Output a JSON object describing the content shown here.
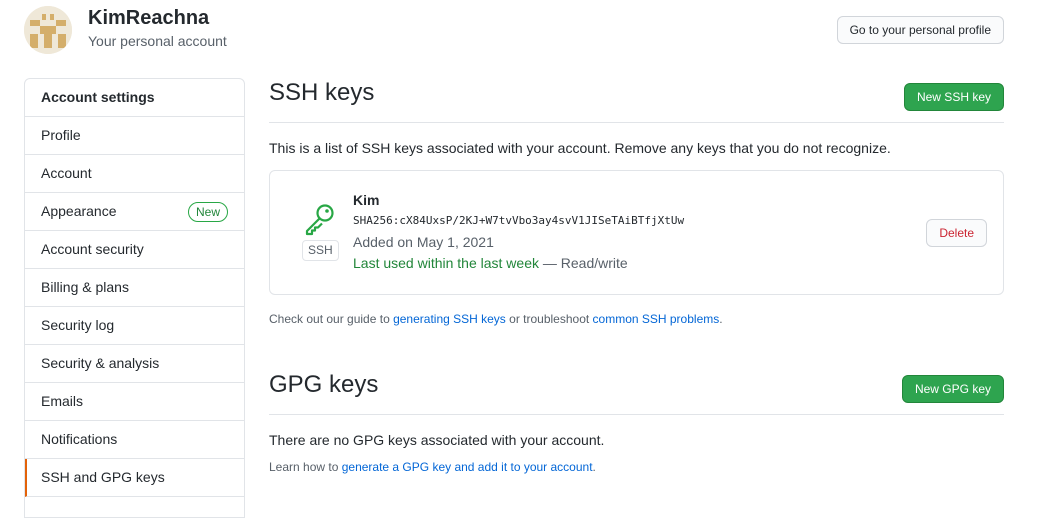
{
  "header": {
    "user_name": "KimReachna",
    "user_subtitle": "Your personal account",
    "profile_button": "Go to your personal profile"
  },
  "sidebar": {
    "heading": "Account settings",
    "items": [
      {
        "label": "Profile"
      },
      {
        "label": "Account"
      },
      {
        "label": "Appearance",
        "badge": "New"
      },
      {
        "label": "Account security"
      },
      {
        "label": "Billing & plans"
      },
      {
        "label": "Security log"
      },
      {
        "label": "Security & analysis"
      },
      {
        "label": "Emails"
      },
      {
        "label": "Notifications"
      },
      {
        "label": "SSH and GPG keys",
        "selected": true
      }
    ]
  },
  "ssh": {
    "title": "SSH keys",
    "new_button": "New SSH key",
    "description": "This is a list of SSH keys associated with your account. Remove any keys that you do not recognize.",
    "keys": [
      {
        "type_label": "SSH",
        "title": "Kim",
        "fingerprint": "SHA256:cX84UxsP/2KJ+W7tvVbo3ay4svV1JISeTAiBTfjXtUw",
        "added": "Added on May 1, 2021",
        "last_used": "Last used within the last week",
        "access": "— Read/write",
        "delete_button": "Delete"
      }
    ],
    "guide_prefix": "Check out our guide to ",
    "guide_link": "generating SSH keys",
    "guide_middle": " or troubleshoot ",
    "guide_link2": "common SSH problems",
    "guide_suffix": "."
  },
  "gpg": {
    "title": "GPG keys",
    "new_button": "New GPG key",
    "empty_text": "There are no GPG keys associated with your account.",
    "learn_prefix": "Learn how to ",
    "learn_link": "generate a GPG key and add it to your account",
    "learn_suffix": "."
  },
  "colors": {
    "primary_green": "#2ea44f",
    "link_blue": "#0366d6",
    "danger_red": "#cb2431",
    "selected_accent": "#e36209",
    "success_text": "#22863a"
  }
}
